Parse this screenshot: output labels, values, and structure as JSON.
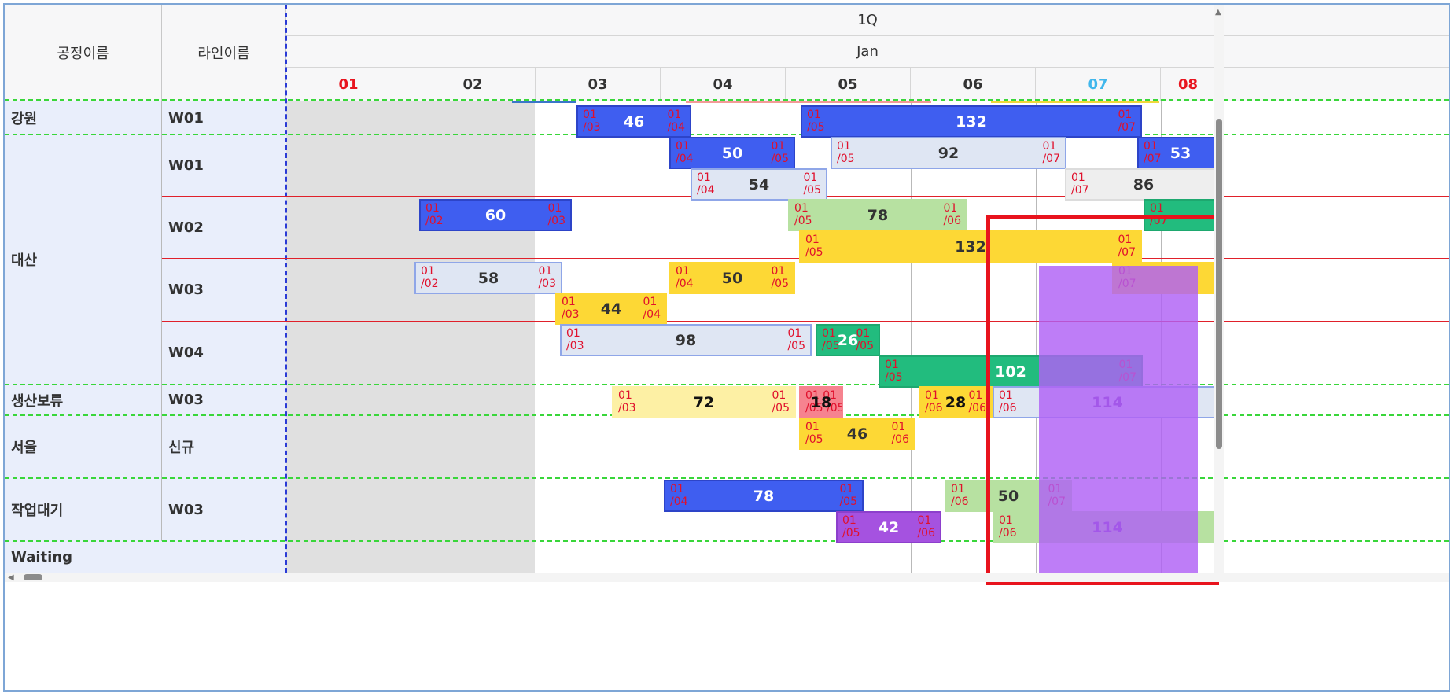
{
  "header": {
    "col_process": "공정이름",
    "col_line": "라인이름",
    "quarter": "1Q",
    "month": "Jan",
    "days": [
      {
        "label": "01",
        "color": "#e8151f"
      },
      {
        "label": "02",
        "color": "#333333"
      },
      {
        "label": "03",
        "color": "#333333"
      },
      {
        "label": "04",
        "color": "#333333"
      },
      {
        "label": "05",
        "color": "#333333"
      },
      {
        "label": "06",
        "color": "#333333"
      },
      {
        "label": "07",
        "color": "#41b7ec"
      },
      {
        "label": "08",
        "color": "#e8151f"
      }
    ]
  },
  "groups": [
    {
      "name": "강원",
      "lines": [
        "W01"
      ]
    },
    {
      "name": "대산",
      "lines": [
        "W01",
        "W02",
        "W03",
        "W04"
      ]
    },
    {
      "name": "생산보류",
      "lines": [
        "W03"
      ]
    },
    {
      "name": "서울",
      "lines": [
        "신규"
      ]
    },
    {
      "name": "작업대기",
      "lines": [
        "W03"
      ]
    },
    {
      "name": "Waiting",
      "lines": []
    }
  ],
  "colors": {
    "blue": "#3f5ef0",
    "light_blue": "#dfe6f3",
    "light_green": "#b7e1a1",
    "yellow": "#fdd835",
    "pale_yellow": "#fdf0a4",
    "green": "#22bc7e",
    "pink": "#f6838f",
    "purple": "#a552e0",
    "gray": "#eeeeee",
    "weekend_bg": "#e0e0e0",
    "group_bg": "#e9eefb",
    "highlight_overlay": "#b060f5",
    "selection_box": "#e8131d"
  },
  "tasks": [
    {
      "value": "46",
      "start": "01\n/03",
      "end": "01\n/04",
      "color": "blue"
    },
    {
      "value": "132",
      "start": "01\n/05",
      "end": "01\n/07",
      "color": "blue"
    },
    {
      "value": "50",
      "start": "01\n/04",
      "end": "01\n/05",
      "color": "blue"
    },
    {
      "value": "92",
      "start": "01\n/05",
      "end": "01\n/07",
      "color": "light_blue"
    },
    {
      "value": "53",
      "start": "01\n/07",
      "end": "",
      "color": "blue"
    },
    {
      "value": "54",
      "start": "01\n/04",
      "end": "01\n/05",
      "color": "light_blue"
    },
    {
      "value": "86",
      "start": "01\n/07",
      "end": "",
      "color": "gray"
    },
    {
      "value": "60",
      "start": "01\n/02",
      "end": "01\n/03",
      "color": "blue"
    },
    {
      "value": "78",
      "start": "01\n/05",
      "end": "01\n/06",
      "color": "light_green"
    },
    {
      "value": "",
      "start": "01\n/07",
      "end": "",
      "color": "green"
    },
    {
      "value": "132",
      "start": "01\n/05",
      "end": "01\n/07",
      "color": "yellow"
    },
    {
      "value": "58",
      "start": "01\n/02",
      "end": "01\n/03",
      "color": "light_blue"
    },
    {
      "value": "50",
      "start": "01\n/04",
      "end": "01\n/05",
      "color": "yellow"
    },
    {
      "value": "",
      "start": "01\n/07",
      "end": "",
      "color": "yellow"
    },
    {
      "value": "44",
      "start": "01\n/03",
      "end": "01\n/04",
      "color": "yellow"
    },
    {
      "value": "98",
      "start": "01\n/03",
      "end": "01\n/05",
      "color": "light_blue"
    },
    {
      "value": "26",
      "start": "01\n/05",
      "end": "01\n/05",
      "color": "green"
    },
    {
      "value": "102",
      "start": "01\n/05",
      "end": "01\n/07",
      "color": "green"
    },
    {
      "value": "72",
      "start": "01\n/03",
      "end": "01\n/05",
      "color": "pale_yellow"
    },
    {
      "value": "18",
      "start": "01 01\n/05 /05",
      "end": "",
      "color": "pink"
    },
    {
      "value": "28",
      "start": "01\n/06",
      "end": "01\n/06",
      "color": "yellow"
    },
    {
      "value": "114",
      "start": "01\n/06",
      "end": "",
      "color": "light_blue"
    },
    {
      "value": "46",
      "start": "01\n/05",
      "end": "01\n/06",
      "color": "yellow"
    },
    {
      "value": "78",
      "start": "01\n/04",
      "end": "01\n/05",
      "color": "blue"
    },
    {
      "value": "50",
      "start": "01\n/06",
      "end": "01\n/07",
      "color": "light_green"
    },
    {
      "value": "42",
      "start": "01\n/05",
      "end": "01\n/06",
      "color": "purple"
    },
    {
      "value": "114",
      "start": "01\n/06",
      "end": "",
      "color": "light_green"
    }
  ]
}
